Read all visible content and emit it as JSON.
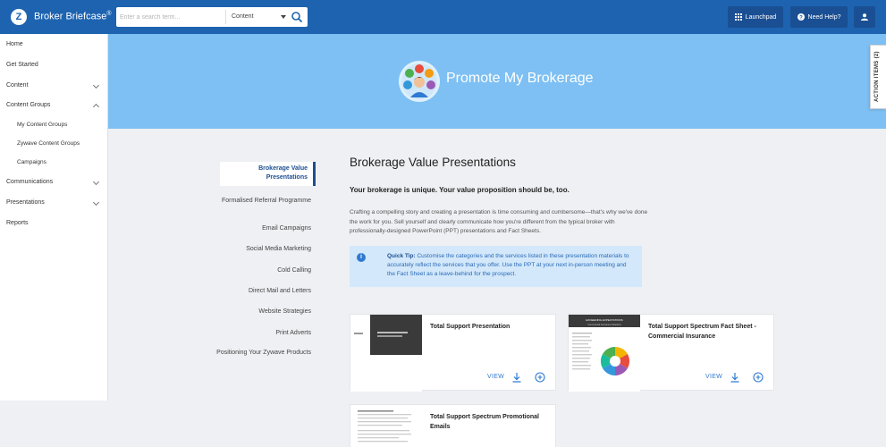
{
  "header": {
    "app_name": "Broker Briefcase",
    "app_mark": "®",
    "logo_letter": "Z",
    "search": {
      "placeholder": "Enter a search term...",
      "scope": "Content"
    },
    "launchpad_label": "Launchpad",
    "help_label": "Need Help?"
  },
  "sidebar": {
    "items": [
      {
        "label": "Home"
      },
      {
        "label": "Get Started"
      },
      {
        "label": "Content"
      },
      {
        "label": "Content Groups"
      },
      {
        "label": "My Content Groups"
      },
      {
        "label": "Zywave Content Groups"
      },
      {
        "label": "Campaigns"
      },
      {
        "label": "Communications"
      },
      {
        "label": "Presentations"
      },
      {
        "label": "Reports"
      }
    ]
  },
  "hero": {
    "title": "Promote My Brokerage",
    "action_items_label": "ACTION ITEMS (2)"
  },
  "subnav": {
    "items": [
      {
        "label": "Brokerage Value Presentations",
        "active": true
      },
      {
        "label": "Formalised Referral Programme"
      },
      {
        "label": "Email Campaigns"
      },
      {
        "label": "Social Media Marketing"
      },
      {
        "label": "Cold Calling"
      },
      {
        "label": "Direct Mail and Letters"
      },
      {
        "label": "Website Strategies"
      },
      {
        "label": "Print Adverts"
      },
      {
        "label": "Positioning Your Zywave Products"
      }
    ]
  },
  "main": {
    "title": "Brokerage Value Presentations",
    "lead": "Your brokerage is unique. Your value proposition should be, too.",
    "body": "Crafting a compelling story and creating a presentation is time consuming and cumbersome—that's why we've done the work for you. Sell yourself and clearly communicate how you're different from the typical broker with professionally-designed PowerPoint (PPT) presentations and Fact Sheets.",
    "tip_label": "Quick Tip:",
    "tip_text": " Customise the categories and the services listed in these presentation materials to accurately reflect the services that you offer. Use the PPT at your next in-person meeting and the Fact Sheet as a leave-behind for the prospect."
  },
  "cards": [
    {
      "title": "Total Support Presentation",
      "view_label": "VIEW"
    },
    {
      "title": "Total Support Spectrum Fact Sheet - Commercial Insurance",
      "view_label": "VIEW",
      "thumb_heading": "EXCEEDING EXPECTATIONS",
      "thumb_sub": "Commercial Insurance Solutions"
    },
    {
      "title": "Total Support Spectrum Promotional Emails"
    }
  ],
  "colors": {
    "topbar": "#1d63b0",
    "hero": "#7ec0f3",
    "accent": "#2f7ad1",
    "active_nav": "#1d4f91",
    "tip_bg": "#d3e8fa"
  }
}
